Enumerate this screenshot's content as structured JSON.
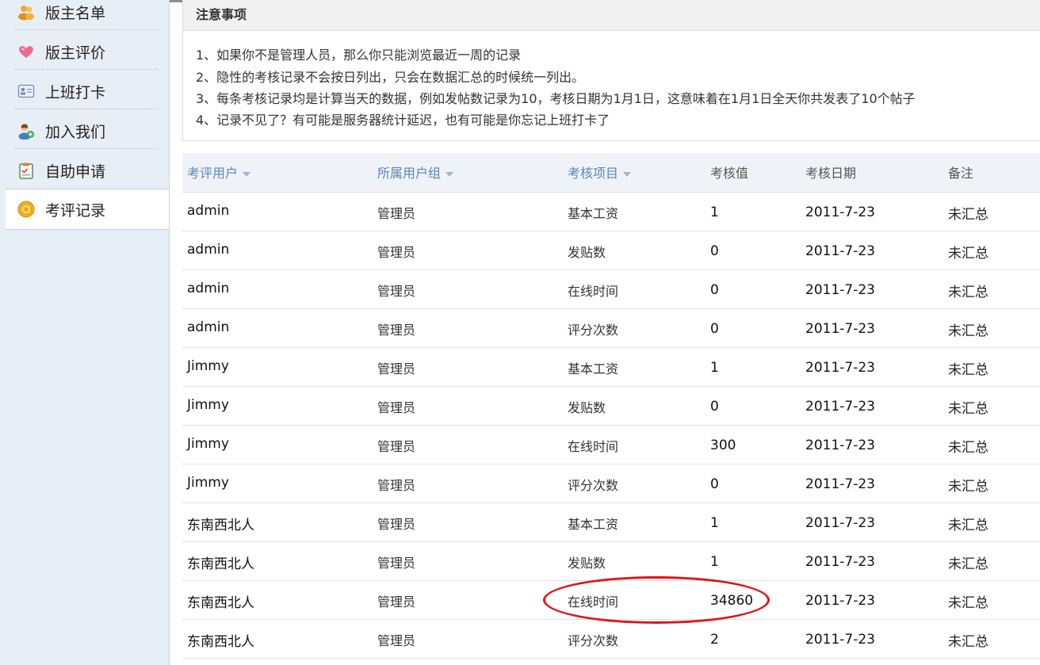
{
  "sidebar": {
    "items": [
      {
        "label": "版主名单",
        "icon": "users-icon"
      },
      {
        "label": "版主评价",
        "icon": "heart-icon"
      },
      {
        "label": "上班打卡",
        "icon": "id-card-icon"
      },
      {
        "label": "加入我们",
        "icon": "add-user-icon"
      },
      {
        "label": "自助申请",
        "icon": "clipboard-icon"
      },
      {
        "label": "考评记录",
        "icon": "coin-icon"
      }
    ]
  },
  "notice": {
    "title": "注意事项",
    "lines": [
      "1、如果你不是管理人员，那么你只能浏览最近一周的记录",
      "2、隐性的考核记录不会按日列出，只会在数据汇总的时候统一列出。",
      "3、每条考核记录均是计算当天的数据，例如发帖数记录为10，考核日期为1月1日，这意味着在1月1日全天你共发表了10个帖子",
      "4、记录不见了？有可能是服务器统计延迟，也有可能是你忘记上班打卡了"
    ]
  },
  "table": {
    "headers": [
      "考评用户",
      "所属用户组",
      "考核项目",
      "考核值",
      "考核日期",
      "备注"
    ],
    "rows": [
      [
        "admin",
        "管理员",
        "基本工资",
        "1",
        "2011-7-23",
        "未汇总"
      ],
      [
        "admin",
        "管理员",
        "发贴数",
        "0",
        "2011-7-23",
        "未汇总"
      ],
      [
        "admin",
        "管理员",
        "在线时间",
        "0",
        "2011-7-23",
        "未汇总"
      ],
      [
        "admin",
        "管理员",
        "评分次数",
        "0",
        "2011-7-23",
        "未汇总"
      ],
      [
        "Jimmy",
        "管理员",
        "基本工资",
        "1",
        "2011-7-23",
        "未汇总"
      ],
      [
        "Jimmy",
        "管理员",
        "发贴数",
        "0",
        "2011-7-23",
        "未汇总"
      ],
      [
        "Jimmy",
        "管理员",
        "在线时间",
        "300",
        "2011-7-23",
        "未汇总"
      ],
      [
        "Jimmy",
        "管理员",
        "评分次数",
        "0",
        "2011-7-23",
        "未汇总"
      ],
      [
        "东南西北人",
        "管理员",
        "基本工资",
        "1",
        "2011-7-23",
        "未汇总"
      ],
      [
        "东南西北人",
        "管理员",
        "发贴数",
        "1",
        "2011-7-23",
        "未汇总"
      ],
      [
        "东南西北人",
        "管理员",
        "在线时间",
        "34860",
        "2011-7-23",
        "未汇总"
      ],
      [
        "东南西北人",
        "管理员",
        "评分次数",
        "2",
        "2011-7-23",
        "未汇总"
      ]
    ]
  },
  "colors": {
    "accent_link": "#5b86b6",
    "highlight_circle": "#e0141a"
  }
}
